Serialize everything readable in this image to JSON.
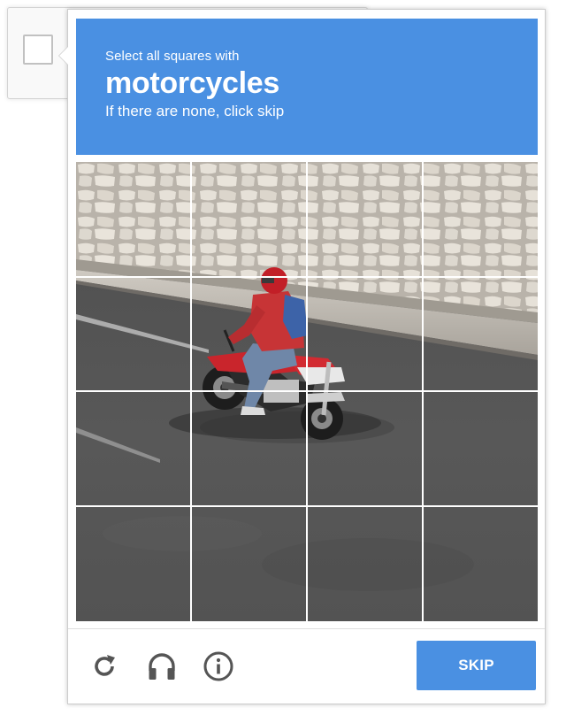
{
  "prompt": {
    "instruction": "Select all squares with",
    "target": "motorcycles",
    "hint": "If there are none, click skip"
  },
  "grid": {
    "rows": 4,
    "columns": 4,
    "tiles": [
      {
        "row": 1,
        "col": 1
      },
      {
        "row": 1,
        "col": 2
      },
      {
        "row": 1,
        "col": 3
      },
      {
        "row": 1,
        "col": 4
      },
      {
        "row": 2,
        "col": 1
      },
      {
        "row": 2,
        "col": 2
      },
      {
        "row": 2,
        "col": 3
      },
      {
        "row": 2,
        "col": 4
      },
      {
        "row": 3,
        "col": 1
      },
      {
        "row": 3,
        "col": 2
      },
      {
        "row": 3,
        "col": 3
      },
      {
        "row": 3,
        "col": 4
      },
      {
        "row": 4,
        "col": 1
      },
      {
        "row": 4,
        "col": 2
      },
      {
        "row": 4,
        "col": 3
      },
      {
        "row": 4,
        "col": 4
      }
    ]
  },
  "footer": {
    "icons": [
      "reload-icon",
      "audio-headphones-icon",
      "info-icon"
    ],
    "skip_label": "SKIP"
  },
  "colors": {
    "accent": "#4a90e2",
    "icon_gray": "#555555"
  }
}
